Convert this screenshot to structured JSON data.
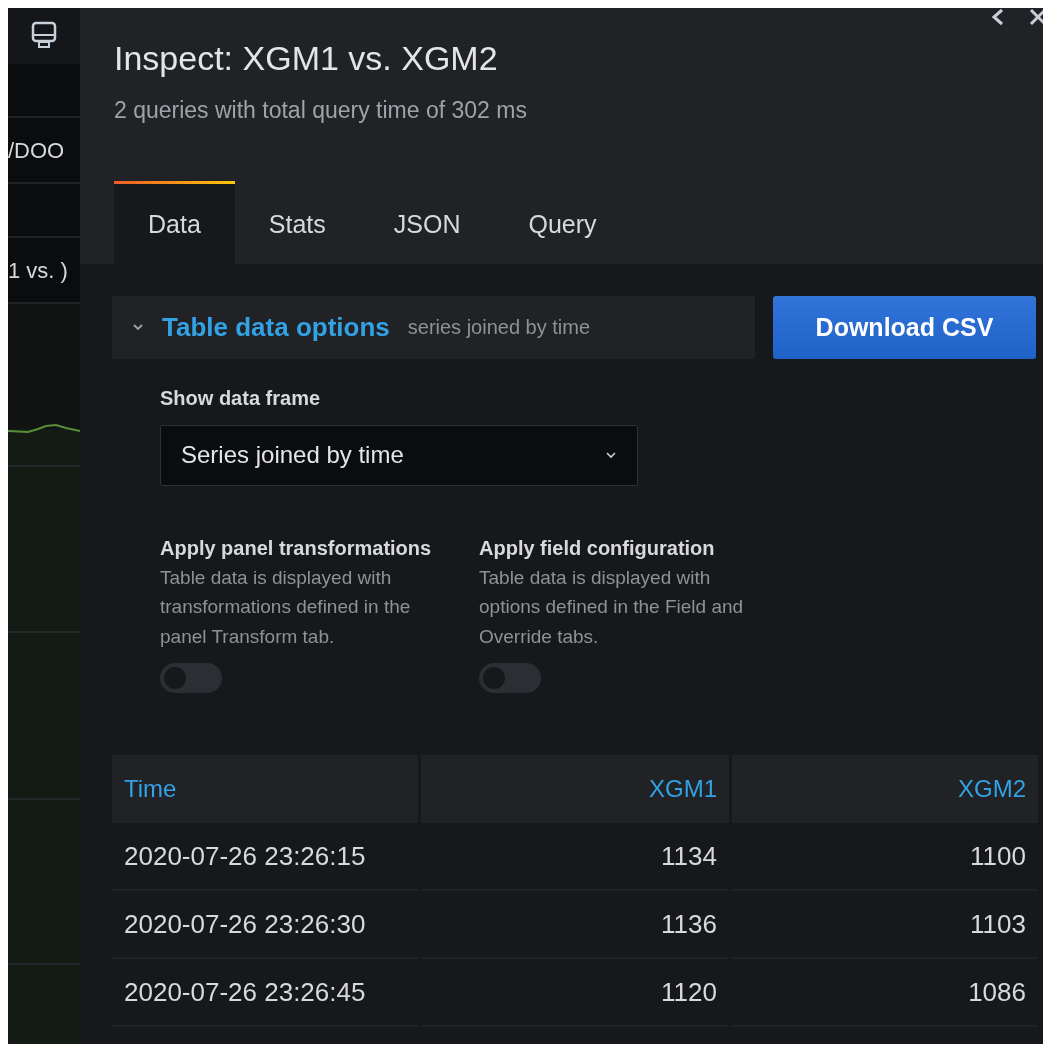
{
  "dashboard_behind": {
    "texts": [
      "/DOO",
      "1 vs. )"
    ]
  },
  "drawer": {
    "title": "Inspect: XGM1 vs. XGM2",
    "subtitle": "2 queries with total query time of 302 ms",
    "tabs": [
      {
        "label": "Data",
        "selected": true
      },
      {
        "label": "Stats",
        "selected": false
      },
      {
        "label": "JSON",
        "selected": false
      },
      {
        "label": "Query",
        "selected": false
      }
    ],
    "options": {
      "expanded": true,
      "title": "Table data options",
      "summary": "series joined by time"
    },
    "download_button": "Download CSV",
    "data_frame": {
      "label": "Show data frame",
      "value": "Series joined by time"
    },
    "toggles": [
      {
        "label": "Apply panel transformations",
        "description": "Table data is displayed with transformations defined in the panel Transform tab.",
        "on": false
      },
      {
        "label": "Apply field configuration",
        "description": "Table data is displayed with options defined in the Field and Override tabs.",
        "on": false
      }
    ],
    "table": {
      "columns": [
        "Time",
        "XGM1",
        "XGM2"
      ],
      "rows": [
        [
          "2020-07-26 23:26:15",
          "1134",
          "1100"
        ],
        [
          "2020-07-26 23:26:30",
          "1136",
          "1103"
        ],
        [
          "2020-07-26 23:26:45",
          "1120",
          "1086"
        ]
      ]
    }
  }
}
